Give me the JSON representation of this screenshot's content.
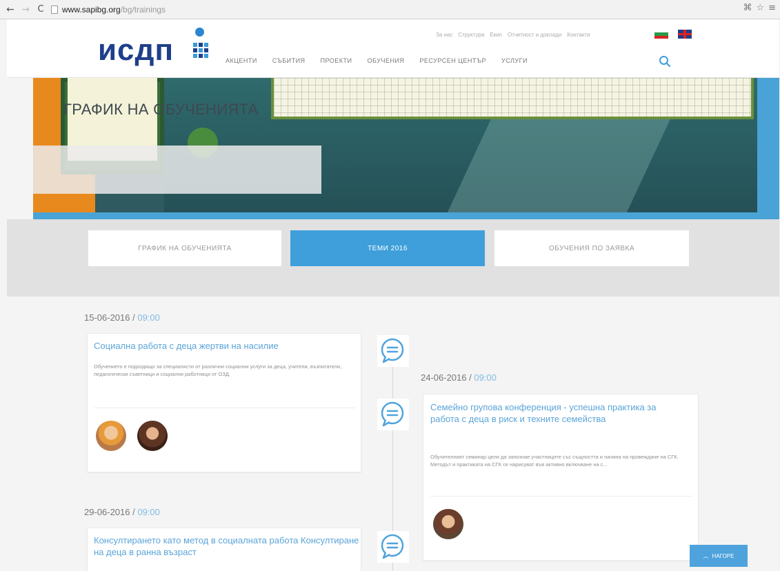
{
  "browser": {
    "url_host": "www.sapibg.org",
    "url_path": "/bg/trainings"
  },
  "header": {
    "logo_text": "исдп",
    "top_links": [
      "За нас",
      "Структура",
      "Екип",
      "Отчетност и доклади",
      "Контакти"
    ],
    "nav_items": [
      "Акценти",
      "Събития",
      "Проекти",
      "Обучения",
      "Ресурсен център",
      "Услуги"
    ]
  },
  "hero": {
    "title": "ГРАФИК НА ОБУЧЕНИЯТА"
  },
  "tabs": [
    {
      "label": "График на обученията",
      "active": false
    },
    {
      "label": "Теми 2016",
      "active": true
    },
    {
      "label": "Обучения по заявка",
      "active": false
    }
  ],
  "events": [
    {
      "date": "15-06-2016",
      "sep": " / ",
      "time": "09:00",
      "title": "Социална работа с деца жертви на насилие",
      "text": "Обучението е подходящо за специалисти от различни социални услуги за деца, учители, възпитатели, педагогически съветници и социални работници от ОЗД."
    },
    {
      "date": "24-06-2016",
      "sep": " / ",
      "time": "09:00",
      "title": "Семейно групова конференция - успешна практика за работа с деца в риск и техните семейства",
      "text": "Обучителният семинар цели да запознае участниците със същността и начина на провеждане на СГК. Методът и практиката на СГК се нарисуват във активно включване на с..."
    },
    {
      "date": "29-06-2016",
      "sep": " / ",
      "time": "09:00",
      "title": "Консултирането като метод в социалната работа Консултиране на деца в ранна възраст"
    }
  ],
  "back_to_top": "НАГОРЕ",
  "colors": {
    "accent": "#3f9fdb",
    "logo_blue": "#1f3f8a"
  }
}
